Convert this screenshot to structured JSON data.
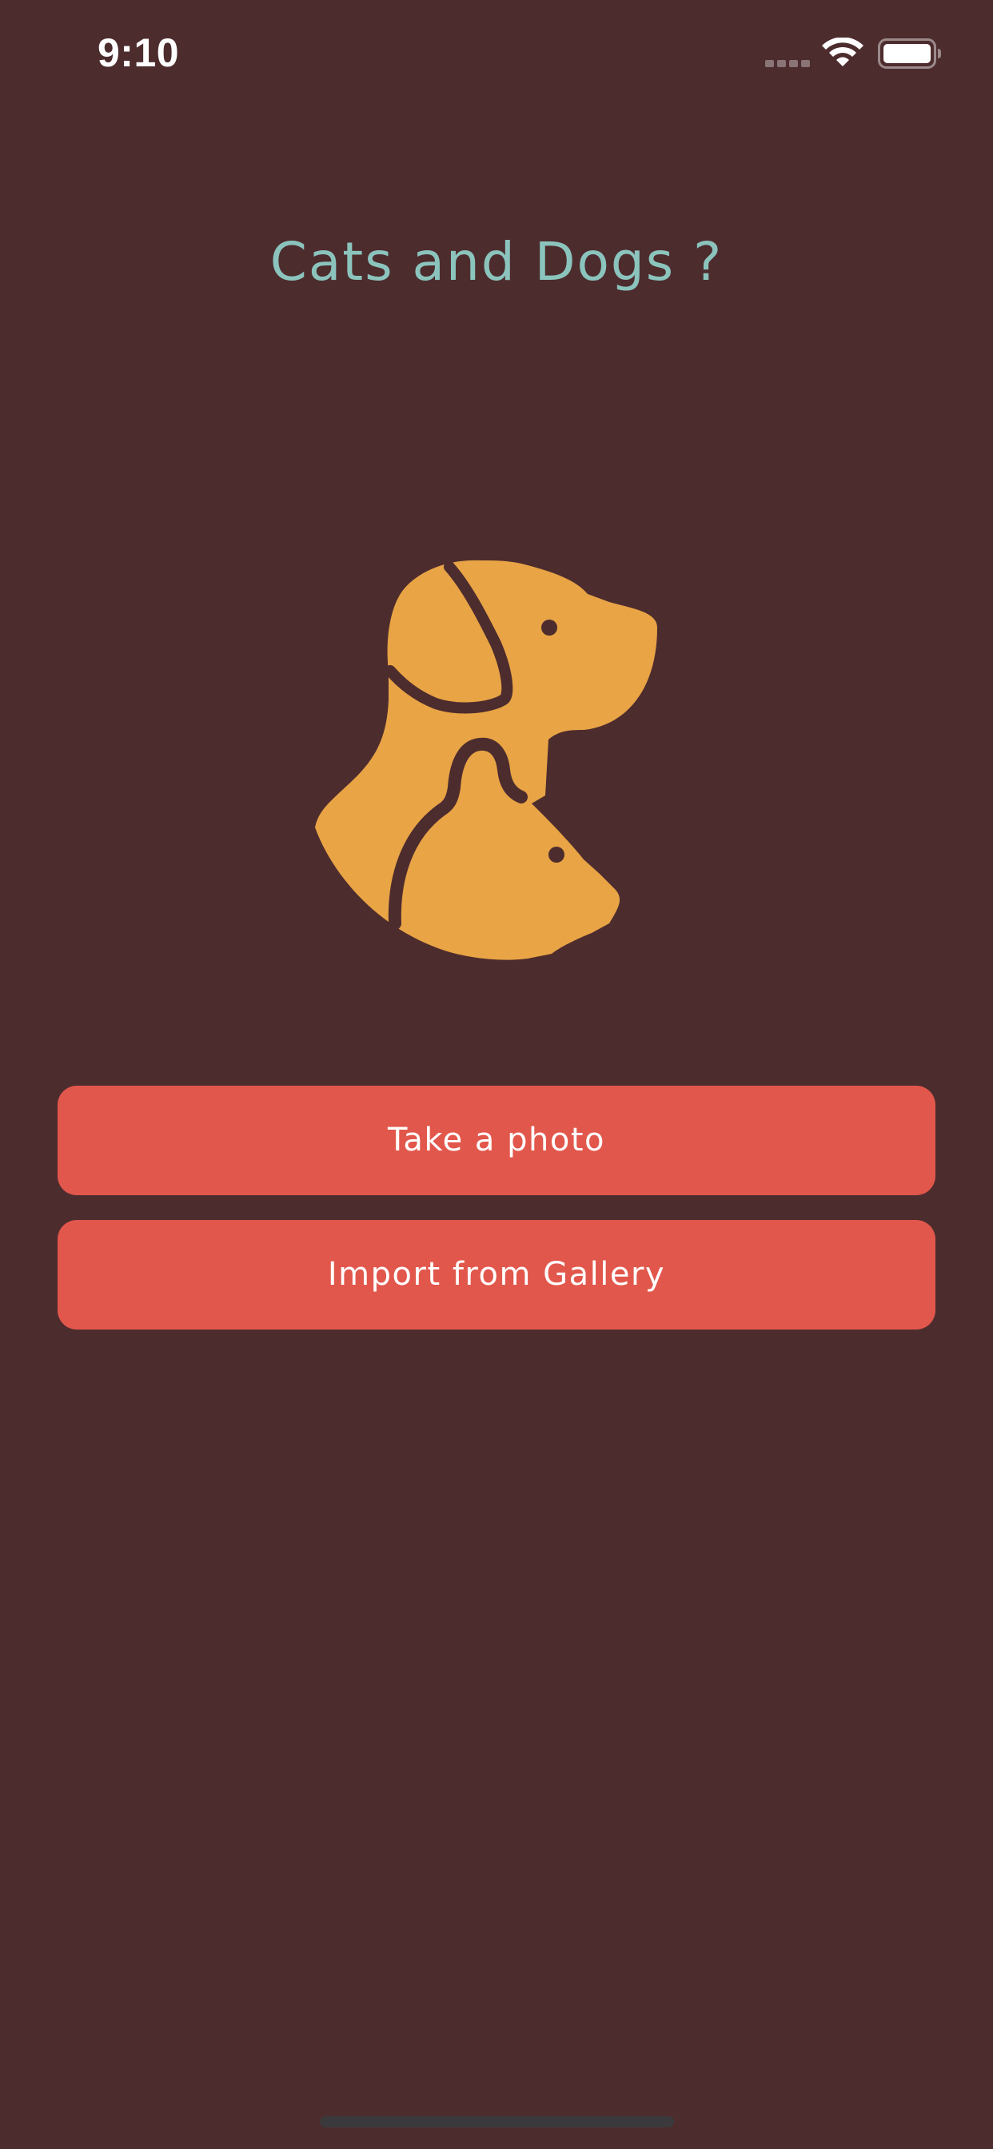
{
  "status_bar": {
    "time": "9:10",
    "icons": [
      "cellular-signal-icon",
      "wifi-icon",
      "battery-icon"
    ]
  },
  "header": {
    "title": "Cats and Dogs ?"
  },
  "illustration": {
    "icon": "dog-and-cat-icon",
    "color": "#e8a445"
  },
  "actions": {
    "take_photo_label": "Take a photo",
    "import_gallery_label": "Import from Gallery"
  },
  "colors": {
    "background": "#4d2c2e",
    "title": "#8bc4bd",
    "button": "#e2574c",
    "button_text": "#ffffff",
    "accent": "#e8a445"
  }
}
